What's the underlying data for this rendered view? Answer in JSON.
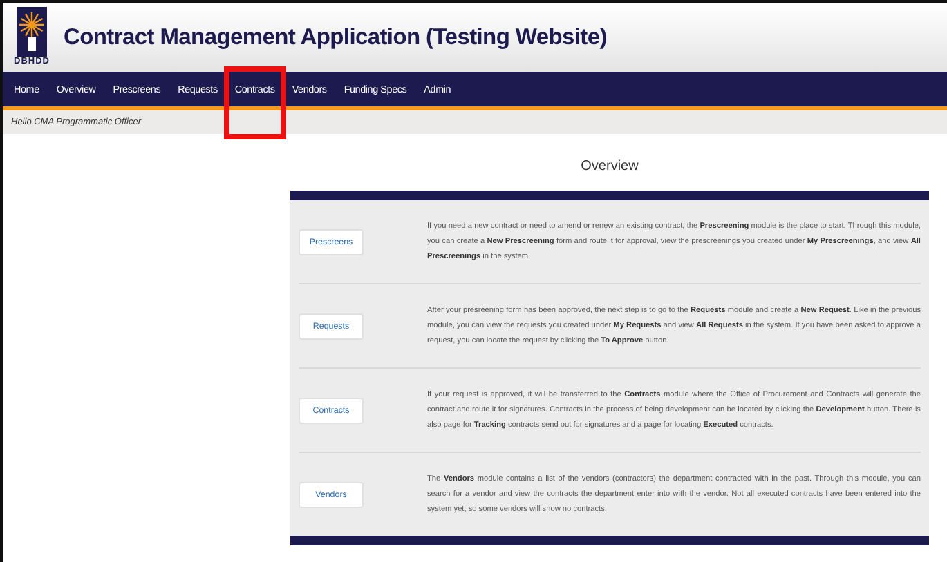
{
  "header": {
    "logo_text": "DBHDD",
    "title": "Contract Management Application (Testing Website)"
  },
  "nav": [
    {
      "label": "Home",
      "highlighted": false
    },
    {
      "label": "Overview",
      "highlighted": false
    },
    {
      "label": "Prescreens",
      "highlighted": false
    },
    {
      "label": "Requests",
      "highlighted": false
    },
    {
      "label": "Contracts",
      "highlighted": true
    },
    {
      "label": "Vendors",
      "highlighted": false
    },
    {
      "label": "Funding Specs",
      "highlighted": false
    },
    {
      "label": "Admin",
      "highlighted": false
    }
  ],
  "greeting": "Hello CMA Programmatic Officer",
  "page_title": "Overview",
  "modules": [
    {
      "button": "Prescreens",
      "description": "If you need a new contract or need to amend or renew an existing contract, the **Prescreening** module is the place to start. Through this module, you can create a **New Prescreening** form and route it for approval, view the prescreenings you created under **My Prescreenings**, and view **All Prescreenings** in the system."
    },
    {
      "button": "Requests",
      "description": "After your presreening form has been approved, the next step is to go to the **Requests** module and create a **New Request**. Like in the previous module, you can view the requests you created under **My Requests** and view **All Requests** in the system. If you have been asked to approve a request, you can locate the request by clicking the **To Approve** button."
    },
    {
      "button": "Contracts",
      "description": "If your request is approved, it will be transferred to the **Contracts** module where the Office of Procurement and Contracts will generate the contract and route it for signatures. Contracts in the process of being development can be located by clicking the **Development** button. There is also page for **Tracking** contracts send out for signatures and a page for locating **Executed** contracts."
    },
    {
      "button": "Vendors",
      "description": "The **Vendors** module contains a list of the vendors (contractors) the department contracted with in the past. Through this module, you can search for a vendor and view the contracts the department enter into with the vendor. Not all executed contracts have been entered into the system yet, so some vendors will show no contracts."
    }
  ]
}
